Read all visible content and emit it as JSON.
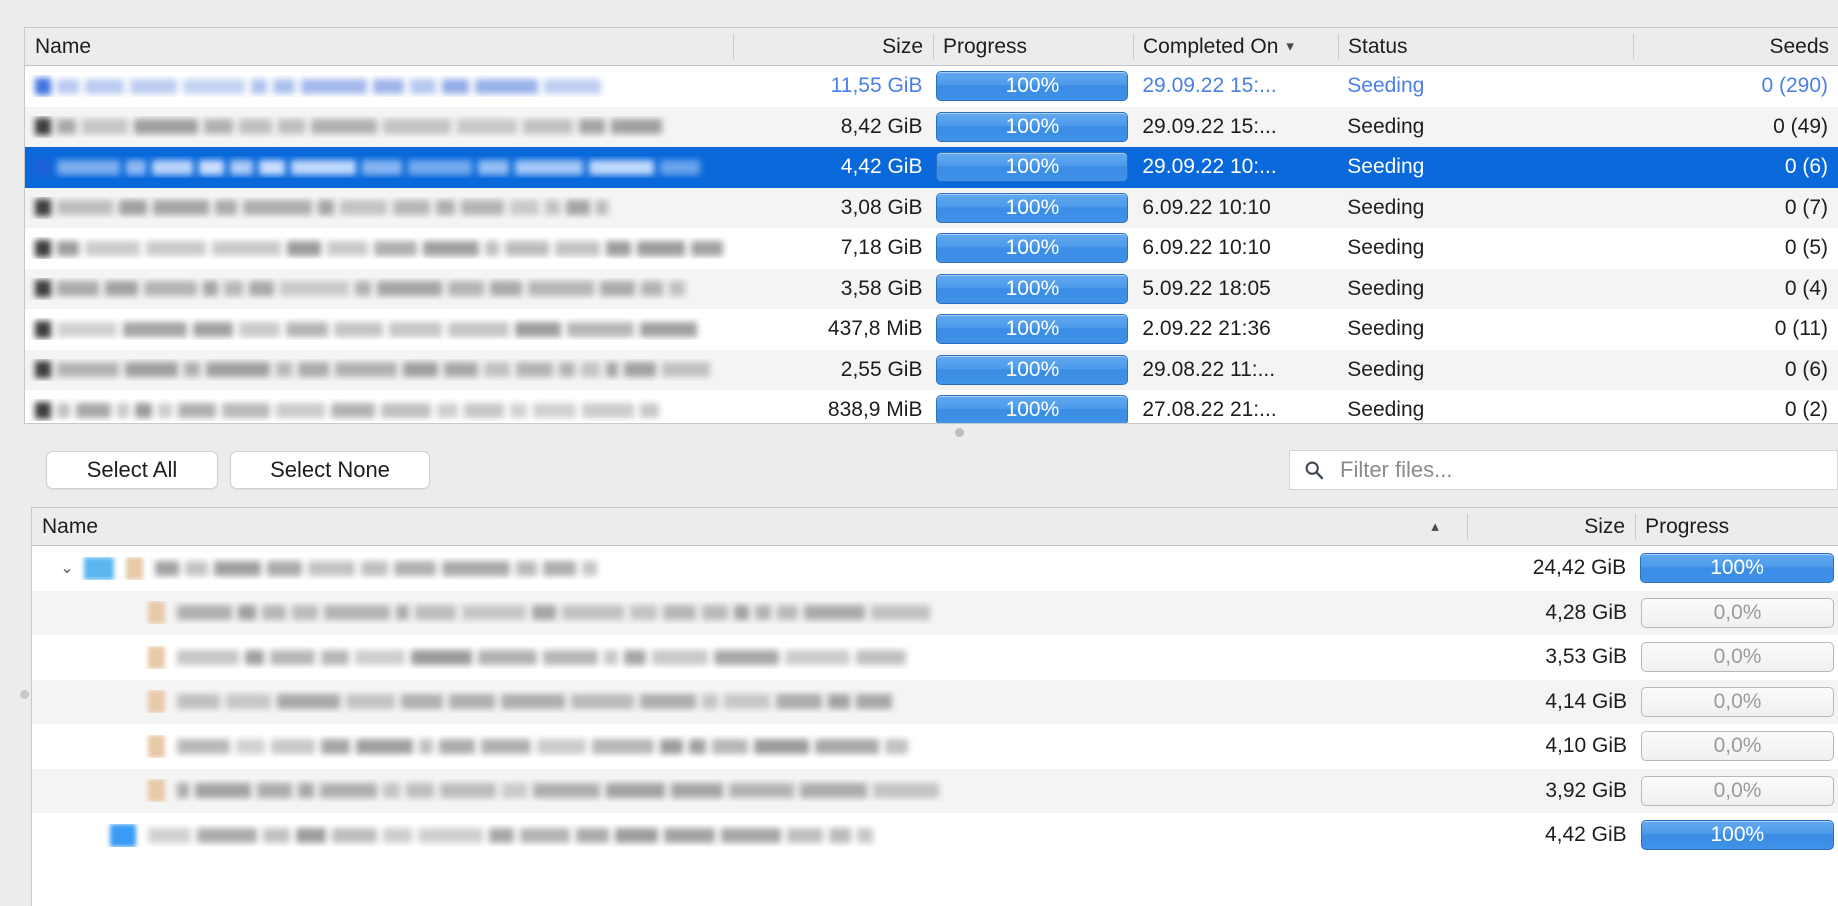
{
  "app": {
    "accent_color": "#0a69da",
    "inactive_selection_text_color": "#4a7fe8",
    "progress_bar_color": "#4d9bea",
    "row_alt_color": "#f4f4f4"
  },
  "torrent_table": {
    "columns": [
      {
        "key": "name",
        "label": "Name",
        "align": "left",
        "sort": "none"
      },
      {
        "key": "size",
        "label": "Size",
        "align": "right",
        "sort": "none"
      },
      {
        "key": "progress",
        "label": "Progress",
        "align": "left",
        "sort": "none"
      },
      {
        "key": "completed_on",
        "label": "Completed On",
        "align": "left",
        "sort": "descending",
        "sort_glyph": "chevron-down-icon"
      },
      {
        "key": "status",
        "label": "Status",
        "align": "left",
        "sort": "none"
      },
      {
        "key": "seeds",
        "label": "Seeds",
        "align": "right",
        "sort": "none"
      }
    ],
    "rows": [
      {
        "name": "",
        "name_redacted": true,
        "size": "11,55 GiB",
        "progress": "100%",
        "progress_value": 100,
        "completed_on": "29.09.22 15:...",
        "status": "Seeding",
        "seeds": "0 (290)",
        "selection": "inactive"
      },
      {
        "name": "",
        "name_redacted": true,
        "size": "8,42 GiB",
        "progress": "100%",
        "progress_value": 100,
        "completed_on": "29.09.22 15:...",
        "status": "Seeding",
        "seeds": "0 (49)",
        "selection": "none"
      },
      {
        "name": "",
        "name_redacted": true,
        "size": "4,42 GiB",
        "progress": "100%",
        "progress_value": 100,
        "completed_on": "29.09.22 10:...",
        "status": "Seeding",
        "seeds": "0 (6)",
        "selection": "active"
      },
      {
        "name": "",
        "name_redacted": true,
        "size": "3,08 GiB",
        "progress": "100%",
        "progress_value": 100,
        "completed_on": "6.09.22 10:10",
        "status": "Seeding",
        "seeds": "0 (7)",
        "selection": "none"
      },
      {
        "name": "",
        "name_redacted": true,
        "size": "7,18 GiB",
        "progress": "100%",
        "progress_value": 100,
        "completed_on": "6.09.22 10:10",
        "status": "Seeding",
        "seeds": "0 (5)",
        "selection": "none"
      },
      {
        "name": "",
        "name_redacted": true,
        "size": "3,58 GiB",
        "progress": "100%",
        "progress_value": 100,
        "completed_on": "5.09.22 18:05",
        "status": "Seeding",
        "seeds": "0 (4)",
        "selection": "none"
      },
      {
        "name": "",
        "name_redacted": true,
        "size": "437,8 MiB",
        "progress": "100%",
        "progress_value": 100,
        "completed_on": "2.09.22 21:36",
        "status": "Seeding",
        "seeds": "0 (11)",
        "selection": "none"
      },
      {
        "name": "",
        "name_redacted": true,
        "size": "2,55 GiB",
        "progress": "100%",
        "progress_value": 100,
        "completed_on": "29.08.22 11:...",
        "status": "Seeding",
        "seeds": "0 (6)",
        "selection": "none"
      },
      {
        "name": "",
        "name_redacted": true,
        "size": "838,9 MiB",
        "progress": "100%",
        "progress_value": 100,
        "completed_on": "27.08.22 21:...",
        "status": "Seeding",
        "seeds": "0 (2)",
        "selection": "none"
      }
    ]
  },
  "toolbar": {
    "select_all_label": "Select All",
    "select_none_label": "Select None",
    "filter_placeholder": "Filter files...",
    "filter_value": "",
    "search_icon": "search-icon"
  },
  "files_table": {
    "columns": [
      {
        "key": "name",
        "label": "Name",
        "align": "left",
        "sort": "ascending",
        "sort_glyph": "chevron-up-icon"
      },
      {
        "key": "size",
        "label": "Size",
        "align": "right",
        "sort": "none"
      },
      {
        "key": "progress",
        "label": "Progress",
        "align": "left",
        "sort": "none"
      }
    ],
    "rows": [
      {
        "name": "",
        "name_redacted": true,
        "depth": 0,
        "expanded": true,
        "icon": "folder-icon",
        "size": "24,42 GiB",
        "progress": "100%",
        "progress_value": 100
      },
      {
        "name": "",
        "name_redacted": true,
        "depth": 1,
        "expanded": false,
        "icon": "file-icon",
        "size": "4,28 GiB",
        "progress": "0,0%",
        "progress_value": 0
      },
      {
        "name": "",
        "name_redacted": true,
        "depth": 1,
        "expanded": false,
        "icon": "file-icon",
        "size": "3,53 GiB",
        "progress": "0,0%",
        "progress_value": 0
      },
      {
        "name": "",
        "name_redacted": true,
        "depth": 1,
        "expanded": false,
        "icon": "file-icon",
        "size": "4,14 GiB",
        "progress": "0,0%",
        "progress_value": 0
      },
      {
        "name": "",
        "name_redacted": true,
        "depth": 1,
        "expanded": false,
        "icon": "file-icon",
        "size": "4,10 GiB",
        "progress": "0,0%",
        "progress_value": 0
      },
      {
        "name": "",
        "name_redacted": true,
        "depth": 1,
        "expanded": false,
        "icon": "file-icon",
        "size": "3,92 GiB",
        "progress": "0,0%",
        "progress_value": 0
      },
      {
        "name": "",
        "name_redacted": true,
        "depth": 2,
        "expanded": false,
        "icon": "media-icon",
        "size": "4,42 GiB",
        "progress": "100%",
        "progress_value": 100
      }
    ]
  }
}
